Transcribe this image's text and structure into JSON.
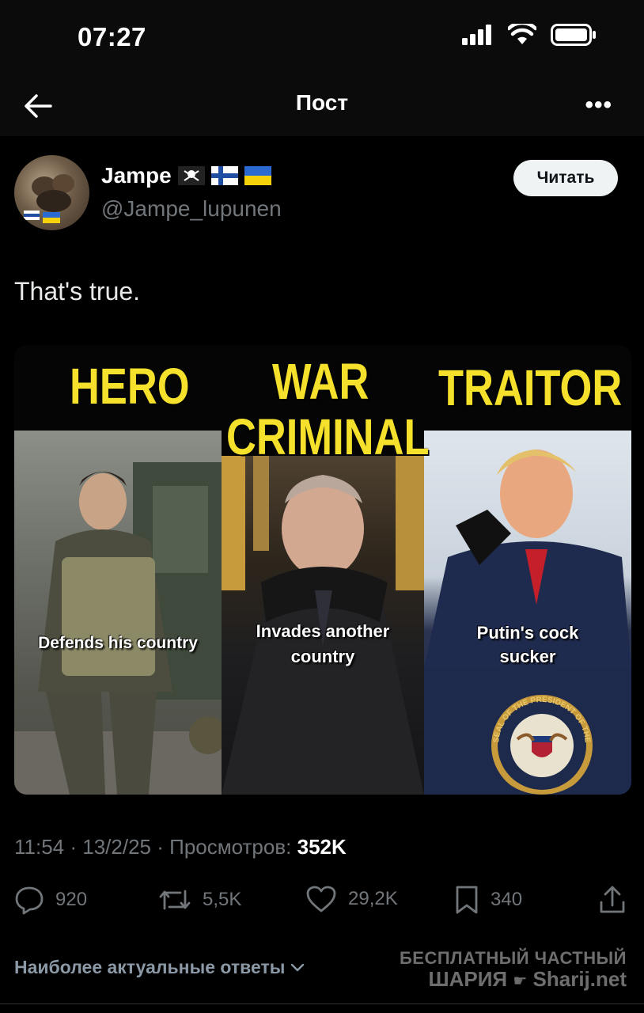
{
  "status_bar": {
    "time": "07:27"
  },
  "nav": {
    "title": "Пост"
  },
  "author": {
    "name": "Jampe",
    "handle": "@Jampe_lupunen",
    "follow_label": "Читать"
  },
  "tweet": {
    "text": "That's true."
  },
  "meme": {
    "headers": {
      "hero": "HERO",
      "war_criminal_1": "WAR",
      "war_criminal_2": "CRIMINAL",
      "traitor": "TRAITOR"
    },
    "captions": {
      "left": "Defends his country",
      "middle_1": "Invades another",
      "middle_2": "country",
      "right_1": "Putin's cock",
      "right_2": "sucker"
    },
    "seal_text": "SEAL OF THE PRESIDENT OF THE UNITED STATES"
  },
  "meta": {
    "time": "11:54",
    "date": "13/2/25",
    "views_label": "Просмотров:",
    "views_count": "352K"
  },
  "actions": {
    "replies": "920",
    "reposts": "5,5K",
    "likes": "29,2K",
    "bookmarks": "340"
  },
  "replies_sort": {
    "label": "Наиболее актуальные ответы"
  },
  "watermark": {
    "line1": "БЕСПЛАТНЫЙ ЧАСТНЫЙ",
    "line2": "ШАРИЯ",
    "line3": "Sharij.net"
  },
  "colors": {
    "accent_text": "#71767b",
    "meme_yellow": "#f5e12b",
    "follow_bg": "#eff3f4"
  }
}
